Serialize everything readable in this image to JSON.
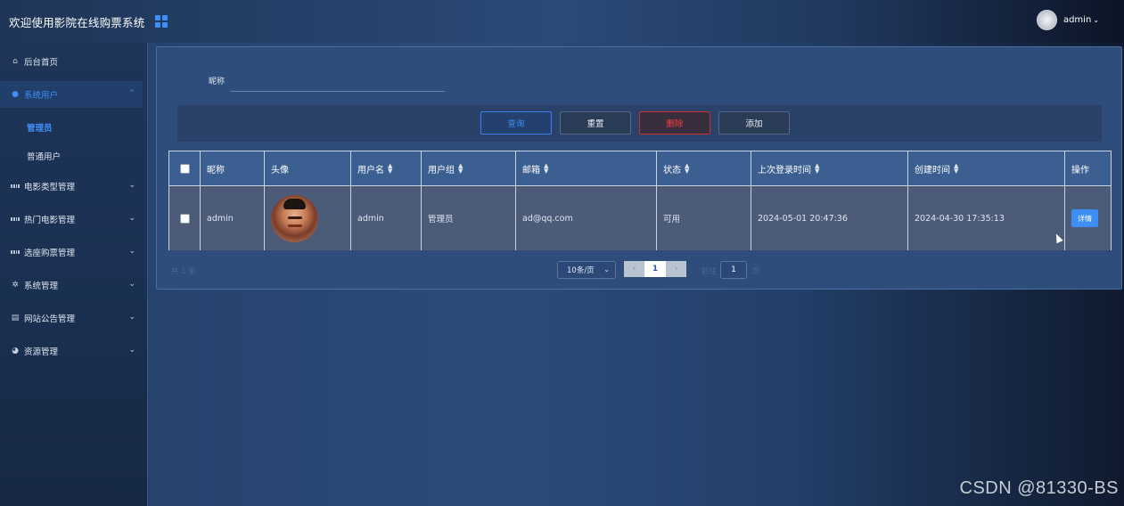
{
  "header": {
    "title": "欢迎使用影院在线购票系统",
    "user_name": "admin"
  },
  "sidebar": {
    "items": [
      {
        "label": "后台首页",
        "icon": "home-icon"
      },
      {
        "label": "系统用户",
        "icon": "user-icon",
        "expanded": true
      },
      {
        "label": "电影类型管理",
        "icon": "grid-icon"
      },
      {
        "label": "热门电影管理",
        "icon": "grid-icon"
      },
      {
        "label": "选座购票管理",
        "icon": "grid-icon"
      },
      {
        "label": "系统管理",
        "icon": "gear-icon"
      },
      {
        "label": "网站公告管理",
        "icon": "document-icon"
      },
      {
        "label": "资源管理",
        "icon": "pie-chart-icon"
      }
    ],
    "sub_items": [
      "管理员",
      "普通用户"
    ]
  },
  "search": {
    "label": "昵称",
    "value": "",
    "placeholder": ""
  },
  "actions": {
    "query": "查询",
    "reset": "重置",
    "delete": "删除",
    "add": "添加"
  },
  "table": {
    "columns": [
      "昵称",
      "头像",
      "用户名",
      "用户组",
      "邮箱",
      "状态",
      "上次登录时间",
      "创建时间",
      "操作"
    ],
    "rows": [
      {
        "nickname": "admin",
        "username": "admin",
        "group": "管理员",
        "email": "ad@qq.com",
        "status": "可用",
        "last_login": "2024-05-01 20:47:36",
        "created": "2024-04-30 17:35:13",
        "action": "详情"
      }
    ]
  },
  "pagination": {
    "total": "共 1 条",
    "page_size": "10条/页",
    "current_page": "1",
    "goto_label": "前往",
    "goto_value": "1",
    "goto_suffix": "页"
  },
  "watermark": "CSDN @81330-BS",
  "colors": {
    "accent": "#3e8ef7",
    "danger": "#ff3b3b",
    "panel": "#2e4d7a"
  }
}
